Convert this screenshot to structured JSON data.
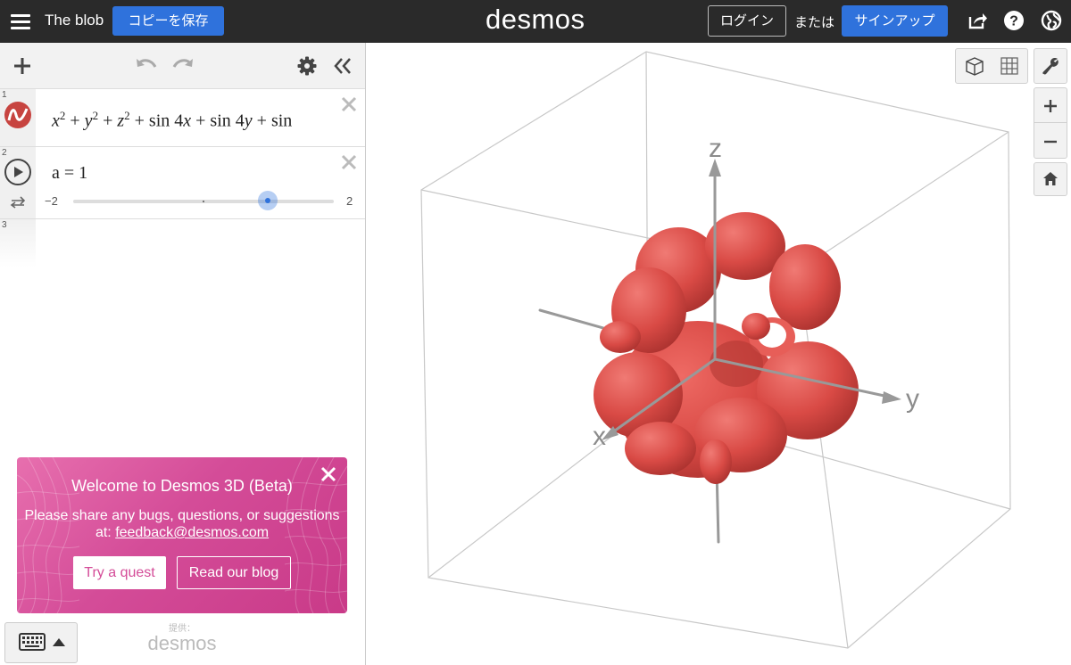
{
  "topbar": {
    "title": "The blob",
    "save_label": "コピーを保存",
    "logo": "desmos",
    "login_label": "ログイン",
    "or_text": "または",
    "signup_label": "サインアップ"
  },
  "expressions": [
    {
      "number": "1",
      "latex_display": "x² + y² + z² + sin 4x + sin 4y + sin",
      "color": "#c74440"
    },
    {
      "number": "2",
      "label": "a = 1",
      "slider_min": "−2",
      "slider_max": "2",
      "value": 1
    },
    {
      "number": "3"
    }
  ],
  "welcome": {
    "title": "Welcome to Desmos 3D (Beta)",
    "text": "Please share any bugs, questions, or suggestions at:",
    "email": "feedback@desmos.com",
    "quest_label": "Try a quest",
    "blog_label": "Read our blog"
  },
  "powered": {
    "label": "提供：",
    "brand": "desmos"
  },
  "graph": {
    "x_label": "x",
    "y_label": "y",
    "z_label": "z",
    "surface_color": "#d94a45"
  }
}
